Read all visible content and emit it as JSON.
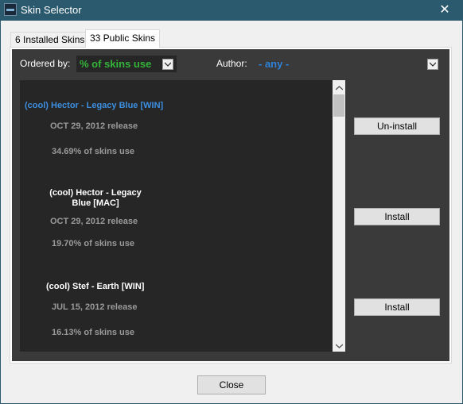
{
  "window": {
    "title": "Skin Selector",
    "close_glyph": "✕"
  },
  "tabs": [
    {
      "label": "6 Installed Skins",
      "active": false
    },
    {
      "label": "33 Public Skins",
      "active": true
    }
  ],
  "filters": {
    "ordered_label": "Ordered by:",
    "ordered_value": "% of skins use",
    "author_label": "Author:",
    "author_value": "- any -"
  },
  "skins": [
    {
      "name": "(cool) Hector - Legacy Blue [WIN]",
      "date": "OCT 29, 2012 release",
      "usage": "34.69% of skins use",
      "button": "Un-install",
      "selected": true
    },
    {
      "name_line1": "(cool) Hector - Legacy",
      "name_line2": "Blue [MAC]",
      "date": "OCT 29, 2012 release",
      "usage": "19.70% of skins use",
      "button": "Install",
      "selected": false
    },
    {
      "name": "(cool) Stef - Earth [WIN]",
      "date": "JUL 15, 2012 release",
      "usage": "16.13% of skins use",
      "button": "Install",
      "selected": false
    }
  ],
  "footer": {
    "close_label": "Close"
  },
  "colors": {
    "titlebar": "#2b5a6e",
    "selected_name": "#3c8fe0",
    "ordered_value": "#34b53a",
    "author_value": "#2e82d9"
  }
}
